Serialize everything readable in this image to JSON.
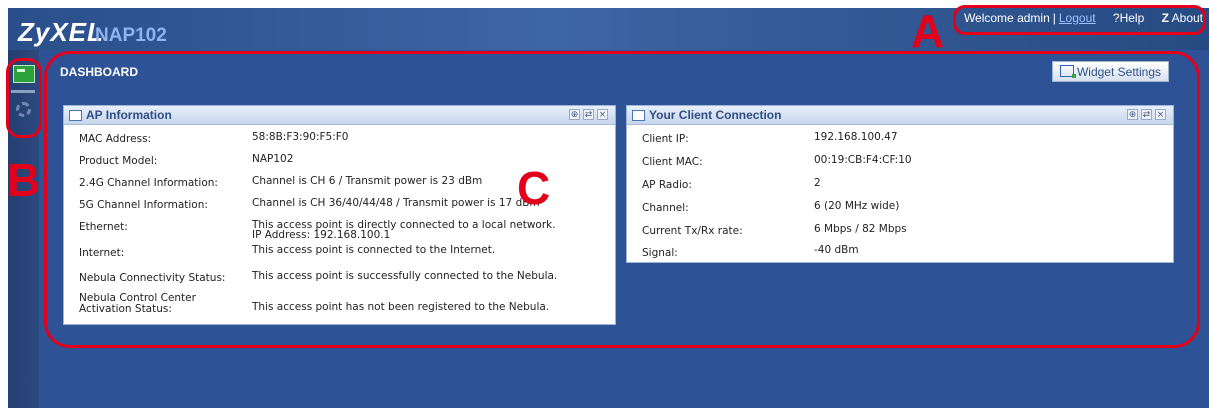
{
  "header": {
    "brand": "ZyXEL",
    "model": "NAP102",
    "welcome": "Welcome admin",
    "separator": "|",
    "logout": "Logout",
    "help": "?Help",
    "about_icon": "Z",
    "about": "About"
  },
  "sidebar": {
    "items": [
      {
        "name": "dashboard-icon"
      },
      {
        "name": "configuration-gear-icon"
      }
    ]
  },
  "dashboard": {
    "title": "DASHBOARD",
    "widget_settings": "Widget Settings"
  },
  "ap_info": {
    "title": "AP Information",
    "controls": [
      "⊕",
      "⇄",
      "×"
    ],
    "rows": [
      {
        "label": "MAC Address:",
        "value": "58:8B:F3:90:F5:F0"
      },
      {
        "label": "Product Model:",
        "value": "NAP102"
      },
      {
        "label": "2.4G Channel Information:",
        "value": "Channel is CH 6 / Transmit power is 23 dBm"
      },
      {
        "label": "5G Channel Information:",
        "value": "Channel is CH 36/40/44/48 / Transmit power is 17 dBm"
      },
      {
        "label": "Ethernet:",
        "value": "This access point is directly connected to a local network.",
        "value2": "IP Address: 192.168.100.1"
      },
      {
        "label": "Internet:",
        "value": "This access point is connected to the Internet."
      },
      {
        "label": "Nebula Connectivity Status:",
        "value": "This access point is successfully connected to the Nebula."
      },
      {
        "label": "Nebula Control Center",
        "label2": "Activation Status:",
        "value": "This access point has not been registered to the Nebula."
      }
    ]
  },
  "client_conn": {
    "title": "Your Client Connection",
    "controls": [
      "⊕",
      "⇄",
      "×"
    ],
    "rows": [
      {
        "label": "Client IP:",
        "value": "192.168.100.47"
      },
      {
        "label": "Client MAC:",
        "value": "00:19:CB:F4:CF:10"
      },
      {
        "label": "AP Radio:",
        "value": "2"
      },
      {
        "label": "Channel:",
        "value": "6 (20 MHz wide)"
      },
      {
        "label": "Current Tx/Rx rate:",
        "value": "6 Mbps / 82 Mbps"
      },
      {
        "label": "Signal:",
        "value": "-40 dBm"
      }
    ]
  },
  "annotations": {
    "a": "A",
    "b": "B",
    "c": "C",
    "color": "#e2001a"
  }
}
